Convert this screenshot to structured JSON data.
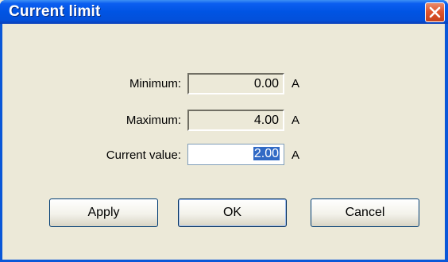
{
  "window": {
    "title": "Current limit"
  },
  "fields": {
    "minimum": {
      "label": "Minimum:",
      "value": "0.00",
      "unit": "A"
    },
    "maximum": {
      "label": "Maximum:",
      "value": "4.00",
      "unit": "A"
    },
    "current": {
      "label": "Current value:",
      "value": "2.00",
      "unit": "A"
    }
  },
  "buttons": {
    "apply": "Apply",
    "ok": "OK",
    "cancel": "Cancel"
  },
  "colors": {
    "titlebar": "#0054e3",
    "background": "#ece9d8",
    "selection": "#316ac5",
    "close": "#e0562f"
  },
  "icons": {
    "close": "close-icon"
  }
}
